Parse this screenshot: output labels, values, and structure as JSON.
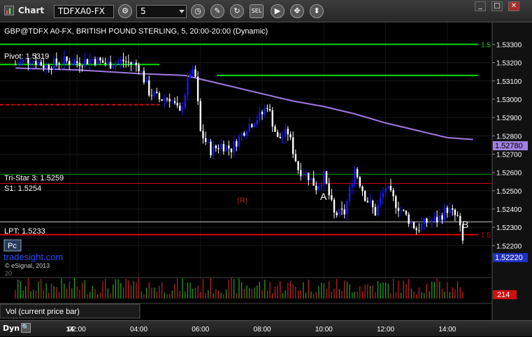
{
  "window": {
    "title": "Chart",
    "symbol": "TDFXA0-FX",
    "interval": "5"
  },
  "toolbar_icons": [
    "clock-icon",
    "pencil-icon",
    "refresh-icon",
    "study-icon",
    "play-icon",
    "cursor-icon"
  ],
  "chart_header": "GBP@TDFX A0-FX, BRITISH POUND STERLING, 5, 20:00-20:00 (Dynamic)",
  "labels": {
    "pivot": "Pivot: 1.5319",
    "tristar": "Tri-Star 3: 1.5259",
    "s1": "S1: 1.5254",
    "lpt": "LPT: 1.5233",
    "r_marker": "(R)",
    "a_marker": "A",
    "b_marker": "B",
    "pc_badge": "Pc",
    "watermark": "tradesight.com",
    "copyright": "© eSignal, 2013",
    "vol_label": "Vol (current price bar)",
    "left_20": "20"
  },
  "bottom": {
    "dyn": "Dyn",
    "date_label": "14"
  },
  "colors": {
    "up": "#1818ff",
    "down": "#ffffff",
    "pivot": "#00dd00",
    "support": "#dd0000",
    "ma": "#a07ae0",
    "vol_up": "#22aa22",
    "vol_down": "#cc2222",
    "last_price_bg": "#2030c0",
    "ma_price_bg": "#a080e0",
    "vol_badge_bg": "#cc1111"
  },
  "chart_data": [
    {
      "type": "candlestick",
      "instrument": "GBP@TDFX A0-FX",
      "interval_minutes": 5,
      "ylim": [
        1.5214,
        1.5342
      ],
      "y_ticks": [
        "1.53300",
        "1.53200",
        "1.53100",
        "1.53000",
        "1.52900",
        "1.52800",
        "1.52700",
        "1.52600",
        "1.52500",
        "1.52400",
        "1.52300",
        "1.52200"
      ],
      "x_ticks": [
        "14",
        "02:00",
        "04:00",
        "06:00",
        "08:00",
        "10:00",
        "12:00",
        "14:00"
      ],
      "last_price": "1.52220",
      "ma_value": "1.52780",
      "price_path": [
        [
          "00:00",
          1.5319
        ],
        [
          "00:30",
          1.5322
        ],
        [
          "01:00",
          1.5318
        ],
        [
          "01:30",
          1.5321
        ],
        [
          "02:00",
          1.532
        ],
        [
          "02:30",
          1.5322
        ],
        [
          "03:00",
          1.5319
        ],
        [
          "03:30",
          1.5321
        ],
        [
          "04:00",
          1.5318
        ],
        [
          "04:20",
          1.5304
        ],
        [
          "04:40",
          1.53
        ],
        [
          "05:00",
          1.5301
        ],
        [
          "05:20",
          1.5292
        ],
        [
          "05:40",
          1.5315
        ],
        [
          "05:50",
          1.5312
        ],
        [
          "06:00",
          1.5282
        ],
        [
          "06:20",
          1.5272
        ],
        [
          "06:40",
          1.5275
        ],
        [
          "07:00",
          1.5273
        ],
        [
          "07:30",
          1.5285
        ],
        [
          "08:00",
          1.5292
        ],
        [
          "08:10",
          1.5297
        ],
        [
          "08:30",
          1.5278
        ],
        [
          "08:50",
          1.5282
        ],
        [
          "09:10",
          1.5262
        ],
        [
          "09:30",
          1.5258
        ],
        [
          "09:45",
          1.5252
        ],
        [
          "10:00",
          1.5258
        ],
        [
          "10:20",
          1.5237
        ],
        [
          "10:40",
          1.5238
        ],
        [
          "11:00",
          1.5262
        ],
        [
          "11:20",
          1.5247
        ],
        [
          "11:40",
          1.5238
        ],
        [
          "12:00",
          1.5252
        ],
        [
          "12:20",
          1.5243
        ],
        [
          "12:40",
          1.5236
        ],
        [
          "13:00",
          1.5229
        ],
        [
          "13:20",
          1.5233
        ],
        [
          "13:40",
          1.5234
        ],
        [
          "14:00",
          1.524
        ],
        [
          "14:20",
          1.5235
        ],
        [
          "14:30",
          1.5222
        ]
      ],
      "moving_average": [
        [
          "00:00",
          1.5317
        ],
        [
          "02:00",
          1.5316
        ],
        [
          "04:00",
          1.5314
        ],
        [
          "05:30",
          1.5313
        ],
        [
          "06:30",
          1.5309
        ],
        [
          "08:00",
          1.5303
        ],
        [
          "09:00",
          1.5299
        ],
        [
          "10:00",
          1.5296
        ],
        [
          "11:00",
          1.5292
        ],
        [
          "12:00",
          1.5287
        ],
        [
          "13:00",
          1.5283
        ],
        [
          "14:00",
          1.5279
        ],
        [
          "14:50",
          1.5278
        ]
      ],
      "horizontal_levels": [
        {
          "name": "pivot",
          "value": 1.533,
          "label": "1.5"
        },
        {
          "name": "pivot-line",
          "value": 1.5319
        },
        {
          "name": "green-level",
          "value": 1.5313
        },
        {
          "name": "red-dashed",
          "value": 1.5297
        },
        {
          "name": "tristar",
          "value": 1.5259
        },
        {
          "name": "s1",
          "value": 1.5254
        },
        {
          "name": "red-low",
          "value": 1.5226,
          "label": "1.5"
        },
        {
          "name": "lpt",
          "value": 1.5233
        }
      ],
      "volume": {
        "current": "214"
      }
    }
  ]
}
